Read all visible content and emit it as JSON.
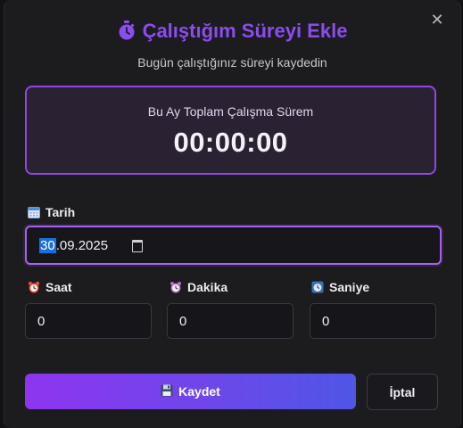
{
  "dialog": {
    "title": "Çalıştığım Süreyi Ekle",
    "subtitle": "Bugün çalıştığınız süreyi kaydedin",
    "close_icon": "close-icon",
    "title_icon": "stopwatch-icon"
  },
  "summary": {
    "label": "Bu Ay Toplam Çalışma Sürem",
    "value": "00:00:00"
  },
  "date_field": {
    "label": "Tarih",
    "icon": "calendar-icon",
    "day": "30",
    "rest": ".09.2025"
  },
  "hours_field": {
    "label": "Saat",
    "icon": "alarm-clock-icon",
    "value": "0"
  },
  "minutes_field": {
    "label": "Dakika",
    "icon": "clock-icon",
    "value": "0"
  },
  "seconds_field": {
    "label": "Saniye",
    "icon": "timer-icon",
    "value": "0"
  },
  "buttons": {
    "save": "Kaydet",
    "save_icon": "floppy-disk-icon",
    "cancel": "İptal"
  },
  "colors": {
    "accent": "#8b4cf0",
    "save_gradient_start": "#8e35f0",
    "save_gradient_end": "#4f56e6",
    "background": "#1c1b1e"
  }
}
